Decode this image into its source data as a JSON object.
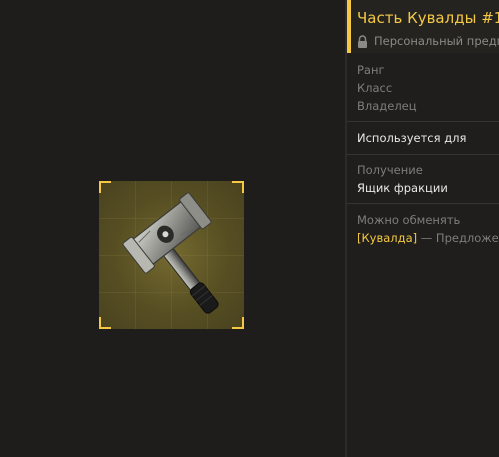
{
  "item": {
    "title": "Часть Кувалды #1",
    "ownership": "Персональный предмет",
    "icon": "hammer-icon",
    "accent_color": "#f5c843"
  },
  "stats": {
    "rank_label": "Ранг",
    "class_label": "Класс",
    "owner_label": "Владелец"
  },
  "usage": {
    "label": "Используется для"
  },
  "obtain": {
    "label": "Получение",
    "value": "Ящик фракции"
  },
  "exchange": {
    "label": "Можно обменять",
    "link": "[Кувалда]",
    "rest": " — Предложение"
  }
}
